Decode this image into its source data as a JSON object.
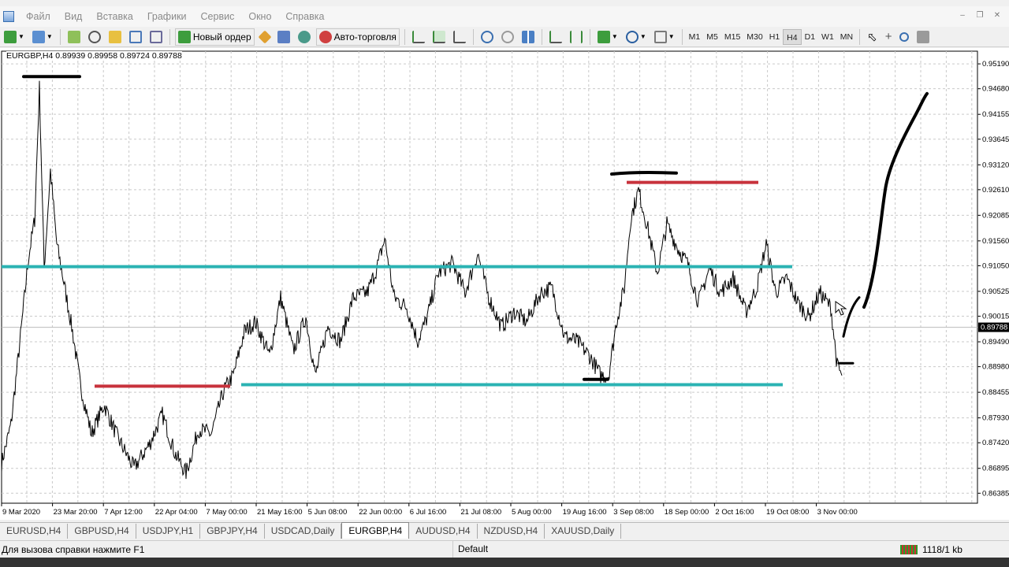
{
  "menu": {
    "items": [
      "Файл",
      "Вид",
      "Вставка",
      "Графики",
      "Сервис",
      "Окно",
      "Справка"
    ]
  },
  "toolbar": {
    "new_order_label": "Новый ордер",
    "autotrading_label": "Авто-торговля",
    "timeframes": [
      "M1",
      "M5",
      "M15",
      "M30",
      "H1",
      "H4",
      "D1",
      "W1",
      "MN"
    ],
    "active_timeframe": "H4"
  },
  "chart": {
    "symbol_info": "EURGBP,H4  0.89939 0.89958 0.89724 0.89788",
    "price_labels": [
      "0.95190",
      "0.94680",
      "0.94155",
      "0.93645",
      "0.93120",
      "0.92610",
      "0.92085",
      "0.91560",
      "0.91050",
      "0.90525",
      "0.90015",
      "0.89490",
      "0.88980",
      "0.88455",
      "0.87930",
      "0.87420",
      "0.86895",
      "0.86385"
    ],
    "current_price": "0.89788",
    "time_labels": [
      "9 Mar 2020",
      "23 Mar 20:00",
      "7 Apr 12:00",
      "22 Apr 04:00",
      "7 May 00:00",
      "21 May 16:00",
      "5 Jun 08:00",
      "22 Jun 00:00",
      "6 Jul 16:00",
      "21 Jul 08:00",
      "5 Aug 00:00",
      "19 Aug 16:00",
      "3 Sep 08:00",
      "18 Sep 00:00",
      "2 Oct 16:00",
      "19 Oct 08:00",
      "3 Nov 00:00"
    ],
    "colors": {
      "support_resistance": "#2bb3b3",
      "red_marks": "#c8323c",
      "drawing": "#000000",
      "grid": "#c9c9c9",
      "price_line": "#000000"
    }
  },
  "tabs": {
    "items": [
      "EURUSD,H4",
      "GBPUSD,H4",
      "USDJPY,H1",
      "GBPJPY,H4",
      "USDCAD,Daily",
      "EURGBP,H4",
      "AUDUSD,H4",
      "NZDUSD,H4",
      "XAUUSD,Daily"
    ],
    "active": "EURGBP,H4"
  },
  "status": {
    "help_text": "Для вызова справки нажмите F1",
    "profile": "Default",
    "connection": "1118/1 kb"
  }
}
